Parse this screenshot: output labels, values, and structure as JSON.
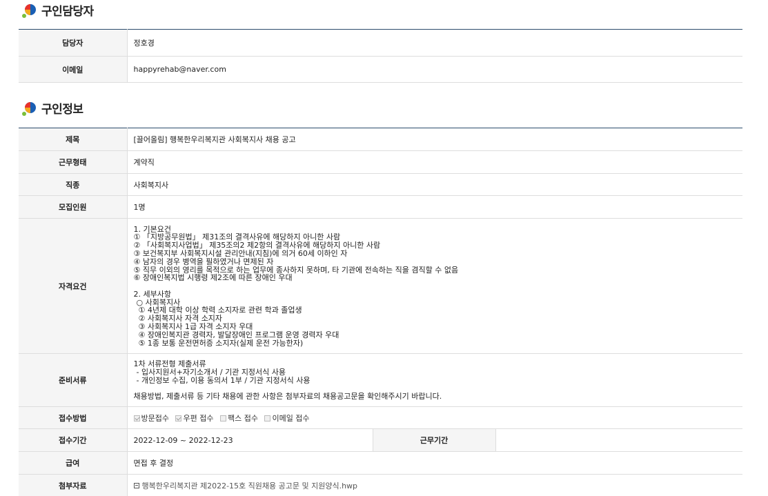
{
  "recruiter_section": {
    "title": "구인담당자",
    "rows": [
      {
        "label": "담당자",
        "value": "정호경"
      },
      {
        "label": "이메일",
        "value": "happyrehab@naver.com"
      }
    ]
  },
  "job_section": {
    "title": "구인정보",
    "title_row": {
      "label": "제목",
      "value": "[끌어올림] 행복한우리복지관 사회복지사 채용 공고"
    },
    "employment_row": {
      "label": "근무형태",
      "value": "계약직"
    },
    "job_type_row": {
      "label": "직종",
      "value": "사회복지사"
    },
    "headcount_row": {
      "label": "모집인원",
      "value": "1명"
    },
    "qualification_row": {
      "label": "자격요건",
      "lines": [
        "1. 기본요건",
        "① 「지방공무원법」 제31조의 결격사유에 해당하지 아니한 사람",
        "② 「사회복지사업법」 제35조의2 제2항의 결격사유에 해당하지 아니한 사람",
        "③ 보건복지부 사회복지시설 관리안내(지침)에 의거 60세 이하인 자",
        "④ 남자의 경우 병역을 필하였거나 면제된 자",
        "⑤ 직무 이외의 영리를 목적으로 하는 업무에 종사하지 못하며, 타 기관에 전속하는 직을 겸직할 수 없음",
        "⑥ 장애인복지법 시행령 제2조에 따른 장애인 우대",
        "",
        "2. 세부사항",
        " ○ 사회복지사",
        "  ① 4년제 대학 이상 학력 소지자로 관련 학과 졸업생",
        "  ② 사회복지사 자격 소지자",
        "  ③ 사회복지사 1급 자격 소지자 우대",
        "  ④ 장애인복지관 경력자, 발달장애인 프로그램 운영 경력자 우대",
        "  ⑤ 1종 보통 운전면허증 소지자(실제 운전 가능한자)"
      ]
    },
    "documents_row": {
      "label": "준비서류",
      "lines": [
        "1차 서류전형 제출서류",
        " - 입사지원서+자기소개서 / 기관 지정서식 사용",
        " - 개인정보 수집, 이용 동의서 1부 / 기관 지정서식 사용",
        "",
        "채용방법, 제출서류 등 기타 채용에 관한 사항은 첨부자료의 채용공고문을 확인해주시기 바랍니다."
      ]
    },
    "apply_method_row": {
      "label": "접수방법",
      "options": [
        {
          "label": "방문접수",
          "checked": true
        },
        {
          "label": "우편 접수",
          "checked": true
        },
        {
          "label": "팩스 접수",
          "checked": false
        },
        {
          "label": "이메일 접수",
          "checked": false
        }
      ]
    },
    "period_row": {
      "label": "접수기간",
      "value": "2022-12-09 ~ 2022-12-23",
      "work_label": "근무기간",
      "work_value": ""
    },
    "salary_row": {
      "label": "급여",
      "value": "면접 후 결정"
    },
    "attachment_row": {
      "label": "첨부자료",
      "file": "행복한우리복지관 제2022-15호 직원채용 공고문 및 지원양식.hwp"
    }
  }
}
